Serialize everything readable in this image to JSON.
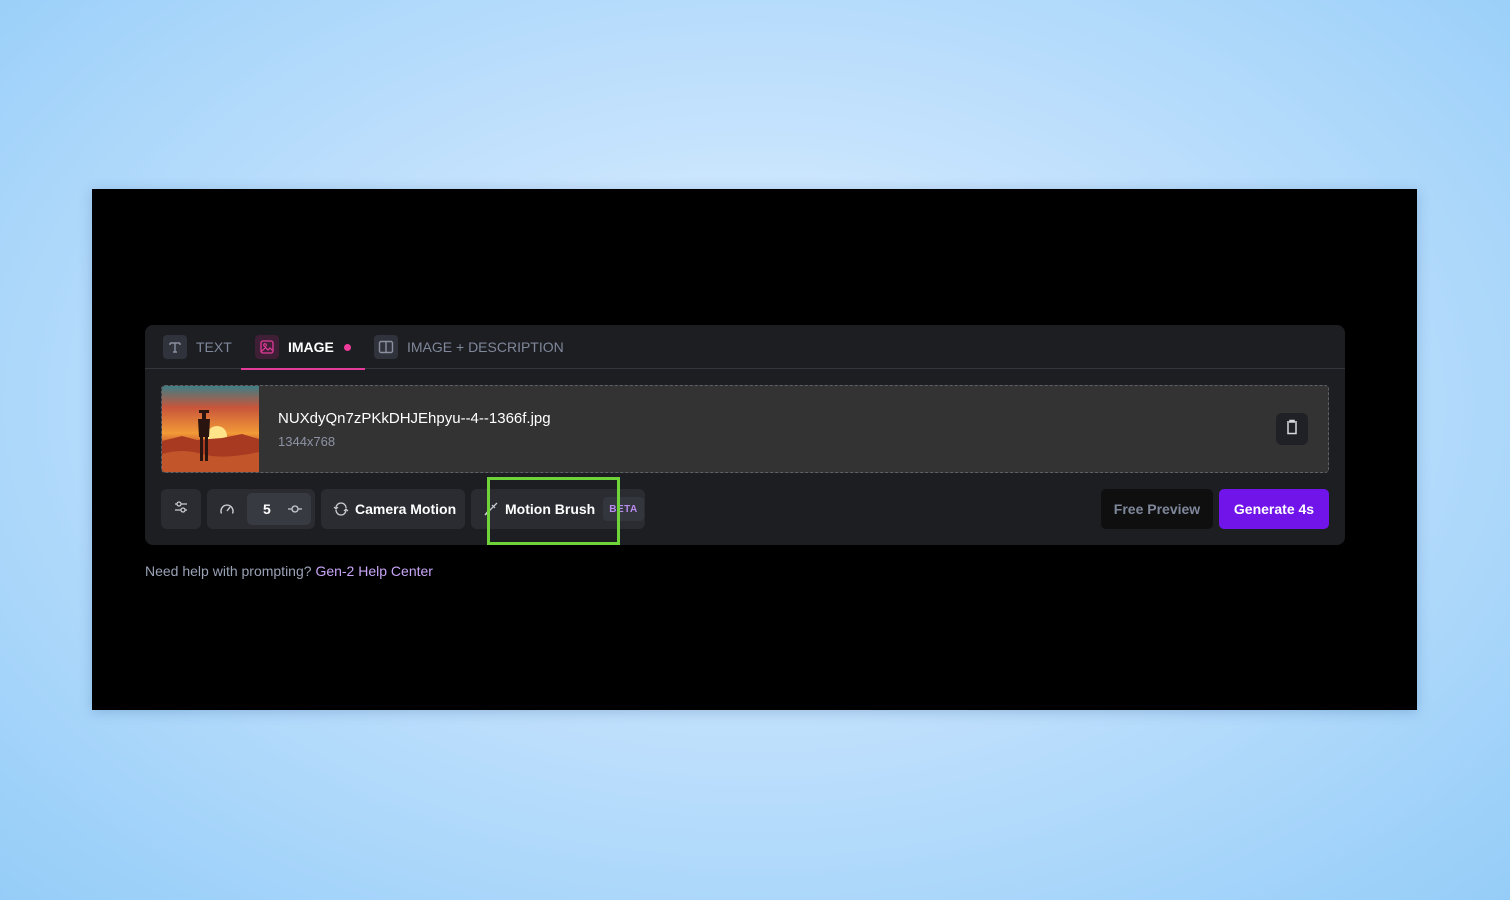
{
  "tabs": [
    {
      "label": "TEXT",
      "icon": "text-icon",
      "active": false
    },
    {
      "label": "IMAGE",
      "icon": "image-icon",
      "active": true,
      "has_dot": true
    },
    {
      "label": "IMAGE + DESCRIPTION",
      "icon": "split-layout-icon",
      "active": false
    }
  ],
  "file": {
    "name": "NUXdyQn7zPKkDHJEhpyu--4--1366f.jpg",
    "dimensions": "1344x768",
    "thumbnail_alt": "cowboy walking toward desert sunset",
    "delete_icon": "trash-icon"
  },
  "toolbar": {
    "settings_icon": "sliders-icon",
    "duration_icon": "speedometer-icon",
    "duration_value": "5",
    "duration_slider_icon": "slider-knob-icon",
    "camera_motion_label": "Camera Motion",
    "camera_motion_icon": "camera-rotate-icon",
    "motion_brush_label": "Motion Brush",
    "motion_brush_icon": "brush-icon",
    "motion_brush_badge": "BETA",
    "free_preview_label": "Free Preview",
    "generate_label": "Generate 4s"
  },
  "help": {
    "text": "Need help with prompting?",
    "link": "Gen-2 Help Center"
  },
  "colors": {
    "accent_pink": "#e23b9a",
    "generate_purple": "#7014ea",
    "highlight_green": "#6fd33a",
    "link_lavender": "#c9a6f7"
  }
}
